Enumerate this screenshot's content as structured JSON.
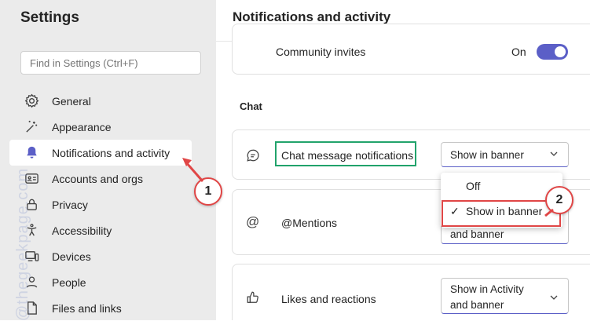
{
  "sidebar": {
    "title": "Settings",
    "search_placeholder": "Find in Settings (Ctrl+F)",
    "items": [
      {
        "label": "General",
        "icon": "gear-icon"
      },
      {
        "label": "Appearance",
        "icon": "wand-icon"
      },
      {
        "label": "Notifications and activity",
        "icon": "bell-icon",
        "active": true
      },
      {
        "label": "Accounts and orgs",
        "icon": "id-card-icon"
      },
      {
        "label": "Privacy",
        "icon": "lock-icon"
      },
      {
        "label": "Accessibility",
        "icon": "accessibility-icon"
      },
      {
        "label": "Devices",
        "icon": "devices-icon"
      },
      {
        "label": "People",
        "icon": "person-icon"
      },
      {
        "label": "Files and links",
        "icon": "file-icon"
      }
    ]
  },
  "main": {
    "title": "Notifications and activity",
    "community": {
      "label": "Community invites",
      "toggle_text": "On",
      "toggle_on": true
    },
    "chat_section": "Chat",
    "chat_message": {
      "label": "Chat message notifications",
      "select_value": "Show in banner"
    },
    "mentions": {
      "label": "@Mentions",
      "partial_value": "and banner"
    },
    "likes": {
      "label": "Likes and reactions",
      "select_line1": "Show in Activity",
      "select_line2": "and banner"
    },
    "dropdown": {
      "options": [
        "Off",
        "Show in banner"
      ],
      "selected": "Show in banner",
      "check": "✓"
    }
  },
  "annotations": {
    "step1": "1",
    "step2": "2",
    "highlight_red": "#e04646",
    "highlight_green": "#21a36b"
  },
  "watermark": "@thegeekpage.com",
  "colors": {
    "accent": "#5b5fc7",
    "sidebar_bg": "#ebebeb"
  }
}
